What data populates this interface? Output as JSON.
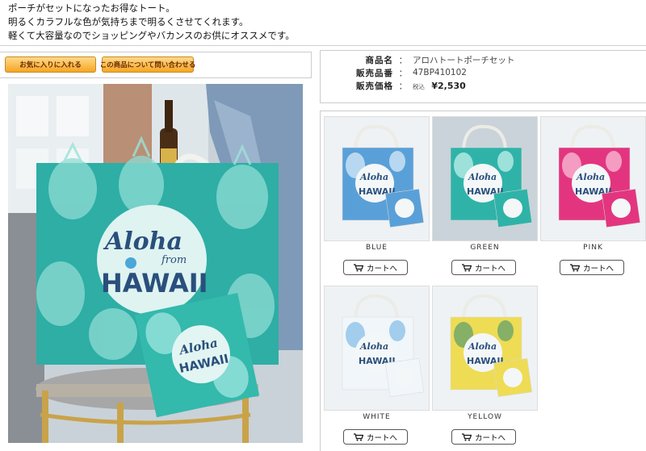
{
  "intro": {
    "line1": "ポーチがセットになったお得なトート。",
    "line2": "明るくカラフルな色が気持ちまで明るくさせてくれます。",
    "line3": "軽くて大容量なのでショッピングやバカンスのお供にオススメです。"
  },
  "actions": {
    "favorite_label": "お気に入りに入れる",
    "inquiry_label": "この商品について問い合わせる"
  },
  "product": {
    "name_label": "商品名",
    "name": "アロハトートポーチセット",
    "code_label": "販売品番",
    "code": "47BP410102",
    "price_label": "販売価格",
    "tax_label": "税込",
    "price": "¥2,530",
    "colon": "："
  },
  "main_image": {
    "logo_script": "Aloha",
    "logo_from": "from",
    "logo_word": "HAWAII"
  },
  "variations": [
    {
      "color": "BLUE",
      "cart_label": "カートへ",
      "bag_color": "#5aa0d8",
      "pattern_color": "#cfe6f7"
    },
    {
      "color": "GREEN",
      "cart_label": "カートへ",
      "bag_color": "#2fb3a8",
      "pattern_color": "#b8ece6"
    },
    {
      "color": "PINK",
      "cart_label": "カートへ",
      "bag_color": "#e3357f",
      "pattern_color": "#f7b6d2"
    },
    {
      "color": "WHITE",
      "cart_label": "カートへ",
      "bag_color": "#f1f6fa",
      "pattern_color": "#8fc3e8"
    },
    {
      "color": "YELLOW",
      "cart_label": "カートへ",
      "bag_color": "#eedc55",
      "pattern_color": "#6aa56a"
    }
  ],
  "icons": {
    "cart": "cart-icon"
  }
}
